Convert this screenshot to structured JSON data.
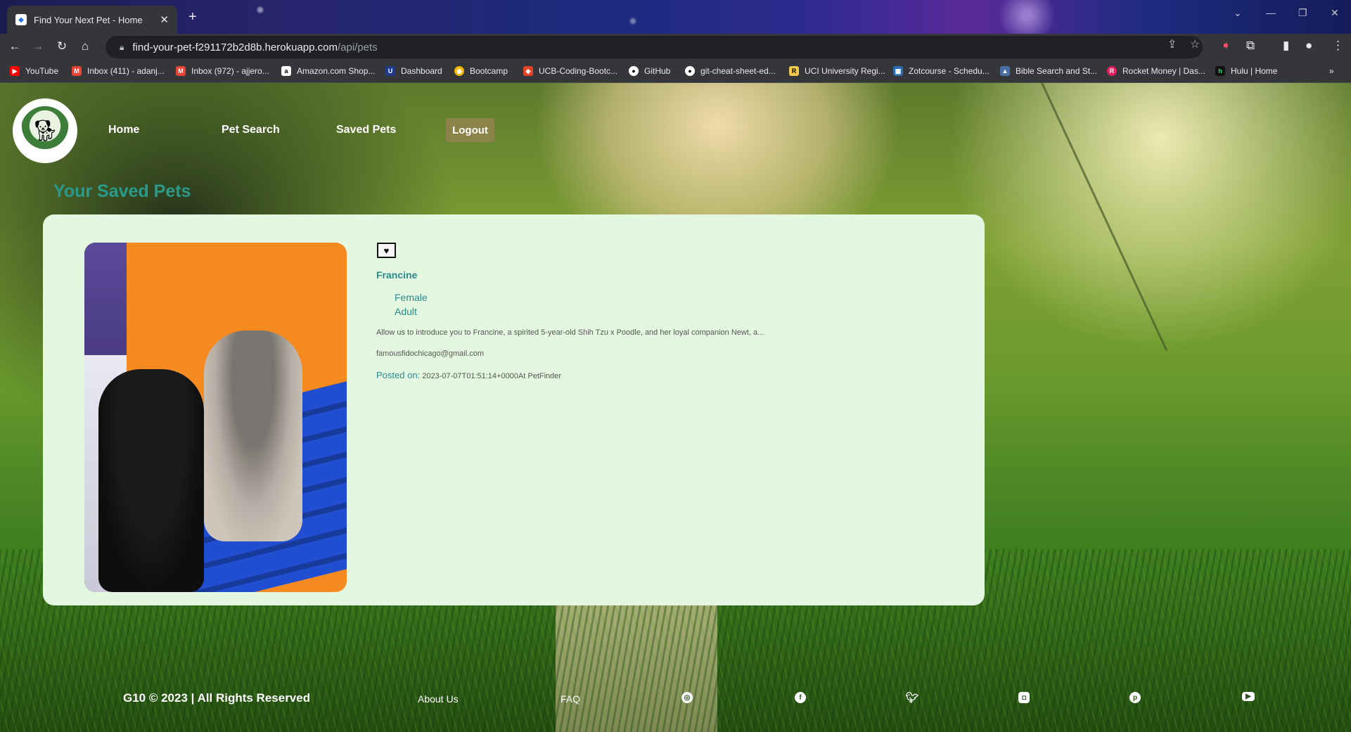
{
  "browser": {
    "tab_title": "Find Your Next Pet - Home",
    "url_host": "find-your-pet-f291172b2d8b.herokuapp.com",
    "url_path": "/api/pets",
    "bookmarks": [
      {
        "label": "YouTube",
        "color": "#ff0000"
      },
      {
        "label": "Inbox (411) - adanj...",
        "color": "#ea4335"
      },
      {
        "label": "Inbox (972) - ajjero...",
        "color": "#ea4335"
      },
      {
        "label": "Amazon.com Shop...",
        "color": "#232f3e"
      },
      {
        "label": "Dashboard",
        "color": "#1e3a8a"
      },
      {
        "label": "Bootcamp",
        "color": "#f4b400"
      },
      {
        "label": "UCB-Coding-Bootc...",
        "color": "#e24329"
      },
      {
        "label": "GitHub",
        "color": "#24292e"
      },
      {
        "label": "git-cheat-sheet-ed...",
        "color": "#24292e"
      },
      {
        "label": "UCI University Regi...",
        "color": "#0064a4"
      },
      {
        "label": "Zotcourse - Schedu...",
        "color": "#2b6cb0"
      },
      {
        "label": "Bible Search and St...",
        "color": "#4a6fa5"
      },
      {
        "label": "Rocket Money | Das...",
        "color": "#e91e63"
      },
      {
        "label": "Hulu | Home",
        "color": "#1ce783"
      }
    ]
  },
  "nav": {
    "items": [
      "Home",
      "Pet Search",
      "Saved Pets"
    ],
    "logout_label": "Logout"
  },
  "page_title": "Your Saved Pets",
  "pet": {
    "name": "Francine",
    "gender": "Female",
    "age": "Adult",
    "description": "Allow us to introduce you to Francine, a spirited 5-year-old Shih Tzu x Poodle, and her loyal companion Newt, a...",
    "email": "famousfidochicago@gmail.com",
    "posted_label": "Posted on:",
    "posted_value": "2023-07-07T01:51:14+0000At PetFinder"
  },
  "footer": {
    "copyright": "G10 © 2023 | All Rights Reserved",
    "links": [
      "About Us",
      "FAQ"
    ]
  },
  "colors": {
    "accent_teal": "#2a9a8a",
    "card_bg": "#e4f7e0",
    "logout_bg": "#8b8348"
  }
}
